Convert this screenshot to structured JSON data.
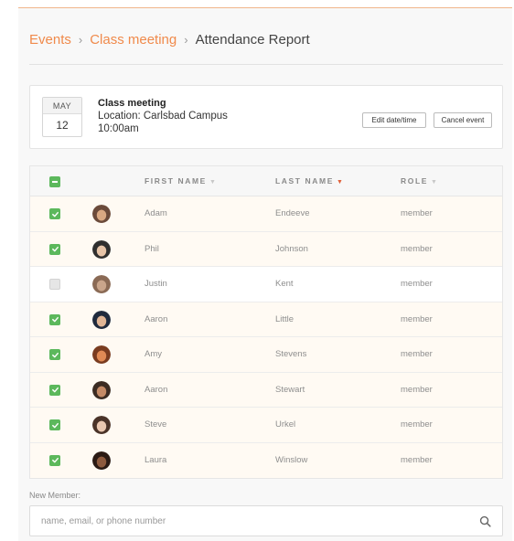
{
  "breadcrumb": {
    "items": [
      "Events",
      "Class meeting"
    ],
    "current": "Attendance Report"
  },
  "event": {
    "month": "MAY",
    "day": "12",
    "title": "Class meeting",
    "location": "Location: Carlsbad Campus",
    "time": "10:00am",
    "edit_label": "Edit date/time",
    "cancel_label": "Cancel event"
  },
  "table": {
    "columns": {
      "first": "FIRST NAME",
      "last": "LAST NAME",
      "role": "ROLE"
    },
    "sort_column": "last",
    "rows": [
      {
        "first": "Adam",
        "last": "Endeeve",
        "role": "member",
        "checked": true
      },
      {
        "first": "Phil",
        "last": "Johnson",
        "role": "member",
        "checked": true
      },
      {
        "first": "Justin",
        "last": "Kent",
        "role": "member",
        "checked": false
      },
      {
        "first": "Aaron",
        "last": "Little",
        "role": "member",
        "checked": true
      },
      {
        "first": "Amy",
        "last": "Stevens",
        "role": "member",
        "checked": true
      },
      {
        "first": "Aaron",
        "last": "Stewart",
        "role": "member",
        "checked": true
      },
      {
        "first": "Steve",
        "last": "Urkel",
        "role": "member",
        "checked": true
      },
      {
        "first": "Laura",
        "last": "Winslow",
        "role": "member",
        "checked": true
      }
    ]
  },
  "new_member": {
    "label": "New Member:",
    "value": "",
    "placeholder": "name, email, or phone number"
  },
  "colors": {
    "accent": "#f08a4b",
    "check_green": "#5cb85c",
    "sort_active": "#e0603a"
  },
  "icons": {
    "sort": "caret-down-icon",
    "search": "search-icon",
    "check": "checkmark-icon"
  }
}
